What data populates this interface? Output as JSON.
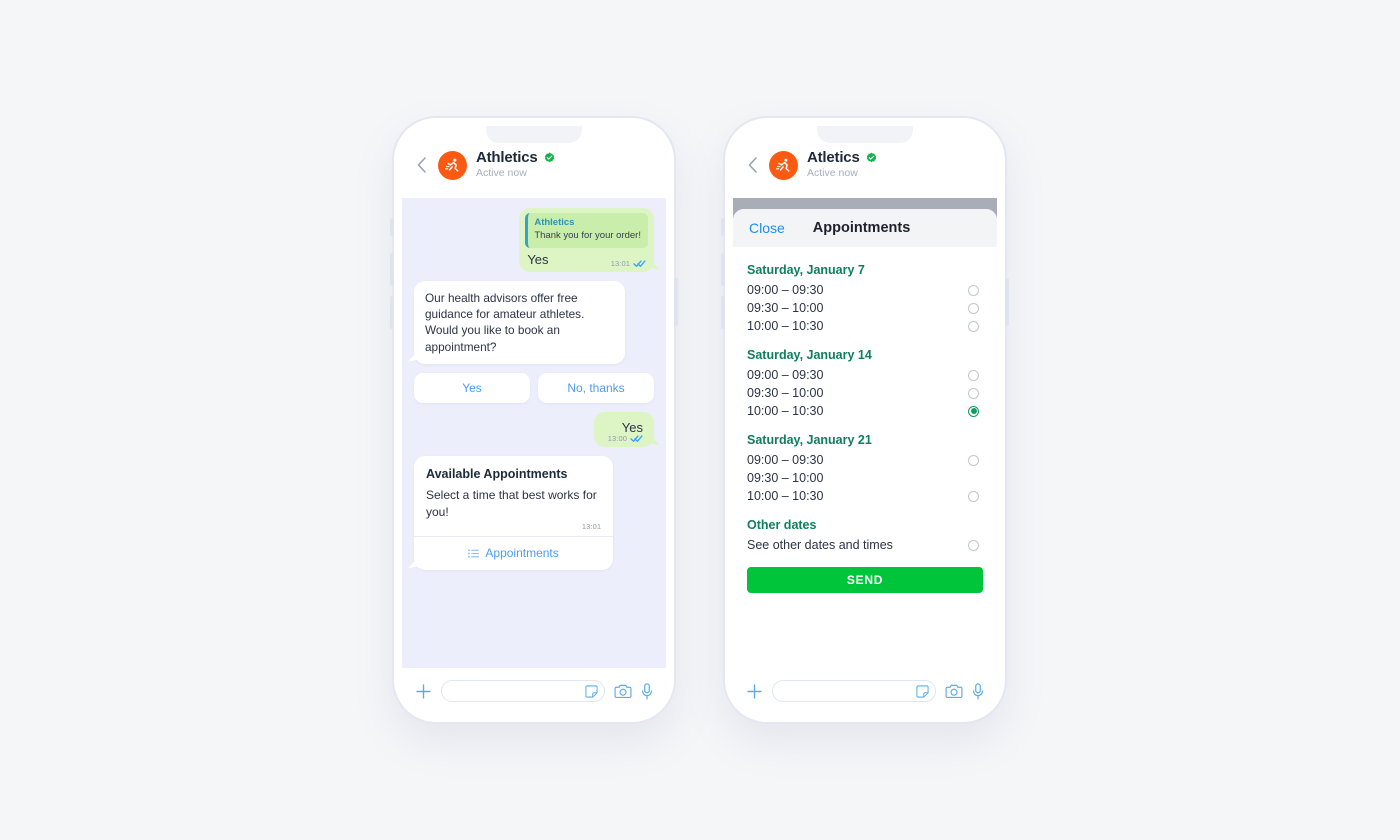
{
  "left_phone": {
    "header": {
      "back_icon": "chevron-left-icon",
      "avatar_icon": "running-athlete-icon",
      "name": "Athletics",
      "verified_icon": "verified-badge-icon",
      "status": "Active now"
    },
    "messages": {
      "quoted_reply": {
        "quote_name": "Athletics",
        "quote_text": "Thank you for your order!",
        "text": "Yes",
        "time": "13:01",
        "status_icon": "double-check-read-icon"
      },
      "incoming": {
        "text": "Our health advisors offer free guidance for amateur athletes. Would you like to book an appointment?"
      },
      "quick_replies": [
        "Yes",
        "No, thanks"
      ],
      "outgoing": {
        "text": "Yes",
        "time": "13:00",
        "status_icon": "double-check-read-icon"
      },
      "card": {
        "title": "Available Appointments",
        "body": "Select a time that best works for you!",
        "time": "13:01",
        "action_icon": "list-icon",
        "action_label": "Appointments"
      }
    },
    "input_bar": {
      "plus_icon": "plus-icon",
      "input_value": "",
      "input_placeholder": "",
      "sticker_icon": "sticker-icon",
      "camera_icon": "camera-icon",
      "mic_icon": "microphone-icon"
    }
  },
  "right_phone": {
    "header": {
      "back_icon": "chevron-left-icon",
      "avatar_icon": "running-athlete-icon",
      "name": "Atletics",
      "verified_icon": "verified-badge-icon",
      "status": "Active now"
    },
    "sheet": {
      "close_label": "Close",
      "title": "Appointments",
      "groups": [
        {
          "title": "Saturday, January 7",
          "slots": [
            {
              "label": "09:00 – 09:30",
              "selected": false,
              "radio_visible": true
            },
            {
              "label": "09:30 – 10:00",
              "selected": false,
              "radio_visible": true
            },
            {
              "label": "10:00 – 10:30",
              "selected": false,
              "radio_visible": true
            }
          ]
        },
        {
          "title": "Saturday, January 14",
          "slots": [
            {
              "label": "09:00 – 09:30",
              "selected": false,
              "radio_visible": true
            },
            {
              "label": "09:30 – 10:00",
              "selected": false,
              "radio_visible": true
            },
            {
              "label": "10:00 – 10:30",
              "selected": true,
              "radio_visible": true
            }
          ]
        },
        {
          "title": "Saturday, January 21",
          "slots": [
            {
              "label": "09:00 – 09:30",
              "selected": false,
              "radio_visible": true
            },
            {
              "label": "09:30 – 10:00",
              "selected": false,
              "radio_visible": false
            },
            {
              "label": "10:00 – 10:30",
              "selected": false,
              "radio_visible": true
            }
          ]
        },
        {
          "title": "Other dates",
          "slots": [
            {
              "label": "See other dates and times",
              "selected": false,
              "radio_visible": true
            }
          ]
        }
      ],
      "send_label": "SEND"
    },
    "input_bar": {
      "plus_icon": "plus-icon",
      "input_value": "",
      "input_placeholder": "",
      "sticker_icon": "sticker-icon",
      "camera_icon": "camera-icon",
      "mic_icon": "microphone-icon"
    }
  },
  "colors": {
    "brand_orange": "#fc5a13",
    "verified_green": "#11b34a",
    "send_green": "#00c53b",
    "heading_green": "#0e7f5c",
    "link_blue": "#4d9cf5",
    "close_blue": "#1e8cf5",
    "outgoing_bubble": "#ddf5c4",
    "chat_background": "#eceefb"
  }
}
